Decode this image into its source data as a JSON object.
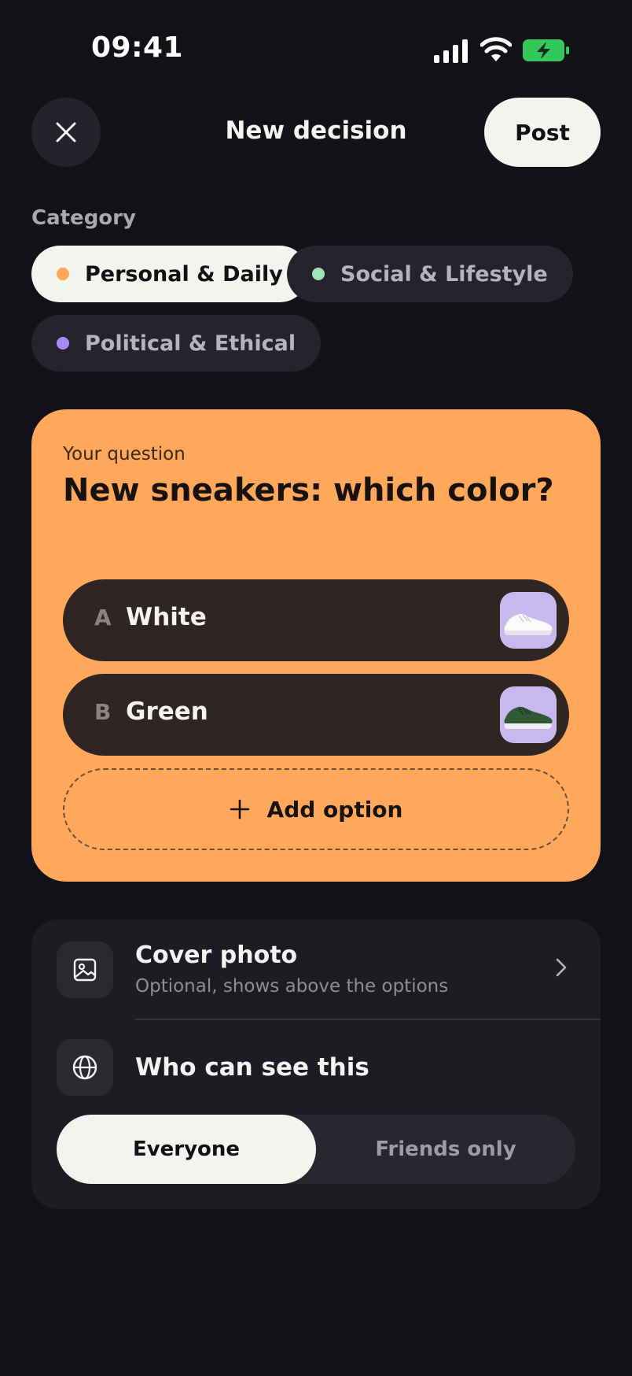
{
  "status_bar": {
    "time": "09:41",
    "icons": [
      "signal-icon",
      "wifi-icon",
      "battery-charging-icon"
    ],
    "battery_color": "#34c759"
  },
  "header": {
    "close_icon": "close-icon",
    "title": "New decision",
    "post_label": "Post"
  },
  "category": {
    "label": "Category",
    "chips": [
      {
        "label": "Personal & Daily",
        "color": "#ffa85c",
        "selected": true
      },
      {
        "label": "Social & Lifestyle",
        "color": "#9ee6b8",
        "selected": false
      },
      {
        "label": "Political & Ethical",
        "color": "#a58cf5",
        "selected": false
      }
    ]
  },
  "question": {
    "label": "Your question",
    "text": "New sneakers: which color?",
    "card_color": "#ffa85c",
    "options": [
      {
        "letter": "A",
        "label": "White",
        "thumbnail": "white-sneaker-image"
      },
      {
        "letter": "B",
        "label": "Green",
        "thumbnail": "green-sneaker-image"
      }
    ],
    "add_option_label": "Add option"
  },
  "settings": {
    "cover_photo": {
      "icon": "image-icon",
      "title": "Cover photo",
      "subtitle": "Optional, shows above the options"
    },
    "visibility": {
      "icon": "globe-icon",
      "title": "Who can see this",
      "options": [
        "Everyone",
        "Friends only"
      ],
      "selected": "Everyone"
    }
  }
}
